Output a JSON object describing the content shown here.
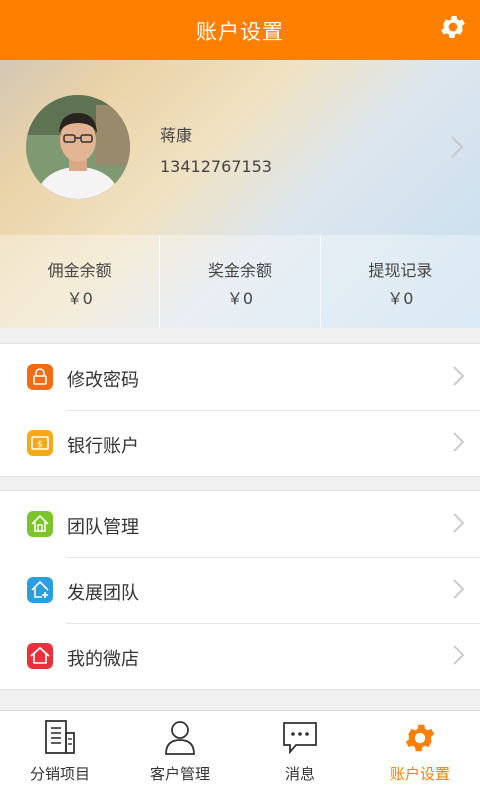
{
  "header": {
    "title": "账户设置",
    "settings_icon": "gear-icon"
  },
  "profile": {
    "name": "蒋康",
    "phone": "13412767153"
  },
  "stats": [
    {
      "label": "佣金余额",
      "value": "￥0"
    },
    {
      "label": "奖金余额",
      "value": "￥0"
    },
    {
      "label": "提现记录",
      "value": "￥0"
    }
  ],
  "menu_group_1": [
    {
      "label": "修改密码",
      "icon": "lock-icon",
      "color": "#f36b12"
    },
    {
      "label": "银行账户",
      "icon": "bank-card-icon",
      "color": "#f7a91a"
    }
  ],
  "menu_group_2": [
    {
      "label": "团队管理",
      "icon": "home-icon",
      "color": "#7cc42a"
    },
    {
      "label": "发展团队",
      "icon": "home-add-icon",
      "color": "#2a9fe0"
    },
    {
      "label": "我的微店",
      "icon": "shop-icon",
      "color": "#e8313a"
    }
  ],
  "tabs": [
    {
      "label": "分销项目",
      "icon": "document-icon"
    },
    {
      "label": "客户管理",
      "icon": "person-icon"
    },
    {
      "label": "消息",
      "icon": "message-icon"
    },
    {
      "label": "账户设置",
      "icon": "gear-icon",
      "active": true
    }
  ],
  "colors": {
    "accent": "#ff7f00"
  }
}
